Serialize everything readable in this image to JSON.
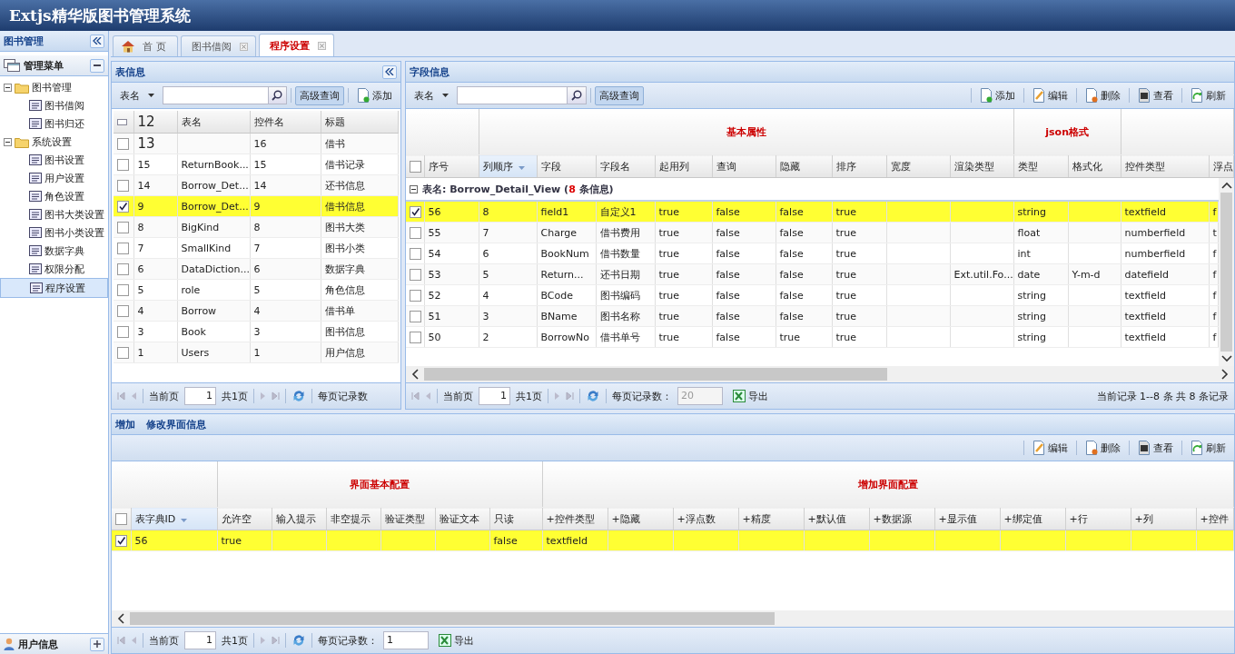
{
  "app": {
    "title": "Extjs精华版图书管理系统"
  },
  "sidebar": {
    "title": "图书管理",
    "section": {
      "title": "管理菜单",
      "expanded": true
    },
    "tree": [
      {
        "label": "图书管理",
        "expanded": true,
        "selected": false,
        "children": [
          {
            "label": "图书借阅",
            "selected": false
          },
          {
            "label": "图书归还",
            "selected": false
          }
        ]
      },
      {
        "label": "系统设置",
        "expanded": true,
        "selected": false,
        "children": [
          {
            "label": "图书设置",
            "selected": false
          },
          {
            "label": "用户设置",
            "selected": false
          },
          {
            "label": "角色设置",
            "selected": false
          },
          {
            "label": "图书大类设置",
            "selected": false
          },
          {
            "label": "图书小类设置",
            "selected": false
          },
          {
            "label": "数据字典",
            "selected": false
          },
          {
            "label": "权限分配",
            "selected": false
          },
          {
            "label": "程序设置",
            "selected": true
          }
        ]
      }
    ],
    "footer": {
      "title": "用户信息"
    }
  },
  "tabs": [
    {
      "label": "首 页",
      "selected": false,
      "closable": false
    },
    {
      "label": "图书借阅",
      "selected": false,
      "closable": true
    },
    {
      "label": "程序设置",
      "selected": true,
      "closable": true
    }
  ],
  "table_panel": {
    "title": "表信息",
    "toolbar": {
      "filter": "表名",
      "search_button": "高级查询",
      "add_button": "添加"
    },
    "columns": [
      "12",
      "表名",
      "控件名",
      "标题"
    ],
    "rows": [
      {
        "id": "13",
        "control": "16",
        "title": "借书",
        "checked": false,
        "selected": false
      },
      {
        "id": "15",
        "name": "ReturnBook...",
        "control": "15",
        "title": "借书记录",
        "checked": false,
        "selected": false
      },
      {
        "id": "14",
        "name": "Borrow_Det...",
        "control": "14",
        "title": "还书信息",
        "checked": false,
        "selected": false
      },
      {
        "id": "9",
        "name": "Borrow_Det...",
        "control": "9",
        "title": "借书信息",
        "checked": true,
        "selected": true
      },
      {
        "id": "8",
        "name": "BigKind",
        "control": "8",
        "title": "图书大类",
        "checked": false,
        "selected": false
      },
      {
        "id": "7",
        "name": "SmallKind",
        "control": "7",
        "title": "图书小类",
        "checked": false,
        "selected": false
      },
      {
        "id": "6",
        "name": "DataDiction...",
        "control": "6",
        "title": "数据字典",
        "checked": false,
        "selected": false
      },
      {
        "id": "5",
        "name": "role",
        "control": "5",
        "title": "角色信息",
        "checked": false,
        "selected": false
      },
      {
        "id": "4",
        "name": "Borrow",
        "control": "4",
        "title": "借书单",
        "checked": false,
        "selected": false
      },
      {
        "id": "3",
        "name": "Book",
        "control": "3",
        "title": "图书信息",
        "checked": false,
        "selected": false
      },
      {
        "id": "1",
        "name": "Users",
        "control": "1",
        "title": "用户信息",
        "checked": false,
        "selected": false
      }
    ],
    "pager": {
      "current_label": "当前页",
      "page": "1",
      "total": "共1页",
      "page_size_label": "每页记录数"
    }
  },
  "field_panel": {
    "title": "字段信息",
    "toolbar": {
      "filter": "表名",
      "search_button": "高级查询",
      "actions": [
        "添加",
        "编辑",
        "删除",
        "查看",
        "刷新"
      ]
    },
    "header_checked": false,
    "column_groups": [
      {
        "columns": [
          {
            "label": "序号",
            "sorted": false
          }
        ]
      },
      {
        "label": "基本属性",
        "columns": [
          {
            "label": "列顺序",
            "sorted": true
          },
          {
            "label": "字段",
            "sorted": false
          },
          {
            "label": "字段名",
            "sorted": false
          },
          {
            "label": "起用列",
            "sorted": false
          },
          {
            "label": "查询",
            "sorted": false
          },
          {
            "label": "隐藏",
            "sorted": false
          },
          {
            "label": "排序",
            "sorted": false
          },
          {
            "label": "宽度",
            "sorted": false
          },
          {
            "label": "渲染类型",
            "sorted": false
          }
        ]
      },
      {
        "label": "json格式",
        "columns": [
          {
            "label": "类型",
            "sorted": false
          },
          {
            "label": "格式化",
            "sorted": false
          }
        ]
      },
      {
        "columns": [
          {
            "label": "控件类型",
            "sorted": false
          },
          {
            "label": "浮点",
            "sorted": false
          }
        ]
      }
    ],
    "group": {
      "expanded": true,
      "prefix": "表名: Borrow_Detail_View (",
      "count": "8",
      "suffix": " 条信息)"
    },
    "rows": [
      {
        "checked": true,
        "selected": true,
        "cells": [
          "56",
          "8",
          "field1",
          "自定义1",
          "true",
          "false",
          "false",
          "true",
          null,
          null,
          "string",
          null,
          "textfield",
          "f"
        ]
      },
      {
        "checked": false,
        "selected": false,
        "cells": [
          "55",
          "7",
          "Charge",
          "借书费用",
          "true",
          "false",
          "false",
          "true",
          null,
          null,
          "float",
          null,
          "numberfield",
          "t"
        ]
      },
      {
        "checked": false,
        "selected": false,
        "cells": [
          "54",
          "6",
          "BookNum",
          "借书数量",
          "true",
          "false",
          "false",
          "true",
          null,
          null,
          "int",
          null,
          "numberfield",
          "f"
        ]
      },
      {
        "checked": false,
        "selected": false,
        "cells": [
          "53",
          "5",
          "Return...",
          "还书日期",
          "true",
          "false",
          "false",
          "true",
          null,
          "Ext.util.Fo...",
          "date",
          "Y-m-d",
          "datefield",
          "f"
        ]
      },
      {
        "checked": false,
        "selected": false,
        "cells": [
          "52",
          "4",
          "BCode",
          "图书编码",
          "true",
          "false",
          "false",
          "true",
          null,
          null,
          "string",
          null,
          "textfield",
          "f"
        ]
      },
      {
        "checked": false,
        "selected": false,
        "cells": [
          "51",
          "3",
          "BName",
          "图书名称",
          "true",
          "false",
          "false",
          "true",
          null,
          null,
          "string",
          null,
          "textfield",
          "f"
        ]
      },
      {
        "checked": false,
        "selected": false,
        "cells": [
          "50",
          "2",
          "BorrowNo",
          "借书单号",
          "true",
          "false",
          "true",
          "true",
          null,
          null,
          "string",
          null,
          "textfield",
          "f"
        ]
      }
    ],
    "pager": {
      "current_label": "当前页",
      "page": "1",
      "total": "共1页",
      "page_size_label": "每页记录数：",
      "page_size": "20",
      "page_size_disabled": true,
      "export": "导出",
      "summary": "当前记录 1--8 条 共 8 条记录"
    }
  },
  "form_panel": {
    "title_items": [
      "增加",
      "修改界面信息"
    ],
    "toolbar": {
      "actions": [
        "编辑",
        "删除",
        "查看",
        "刷新"
      ]
    },
    "header_checked": false,
    "column_groups": [
      {
        "columns": [
          {
            "label": "表字典ID",
            "sorted": true
          }
        ]
      },
      {
        "label": "界面基本配置",
        "columns": [
          {
            "label": "允许空",
            "sorted": false
          },
          {
            "label": "输入提示",
            "sorted": false
          },
          {
            "label": "非空提示",
            "sorted": false
          },
          {
            "label": "验证类型",
            "sorted": false
          },
          {
            "label": "验证文本",
            "sorted": false
          },
          {
            "label": "只读",
            "sorted": false
          }
        ]
      },
      {
        "label": "增加界面配置",
        "columns": [
          {
            "label": "+控件类型",
            "sorted": false
          },
          {
            "label": "+隐藏",
            "sorted": false
          },
          {
            "label": "+浮点数",
            "sorted": false
          },
          {
            "label": "+精度",
            "sorted": false
          },
          {
            "label": "+默认值",
            "sorted": false
          },
          {
            "label": "+数据源",
            "sorted": false
          },
          {
            "label": "+显示值",
            "sorted": false
          },
          {
            "label": "+绑定值",
            "sorted": false
          },
          {
            "label": "+行",
            "sorted": false
          },
          {
            "label": "+列",
            "sorted": false
          },
          {
            "label": "+控件",
            "sorted": false
          }
        ]
      }
    ],
    "rows": [
      {
        "checked": true,
        "selected": true,
        "cells": [
          "56",
          "true",
          null,
          null,
          null,
          null,
          "false",
          "textfield"
        ]
      }
    ],
    "pager": {
      "current_label": "当前页",
      "page": "1",
      "total": "共1页",
      "page_size_label": "每页记录数：",
      "page_size": "1",
      "page_size_disabled": false,
      "export": "导出"
    }
  }
}
